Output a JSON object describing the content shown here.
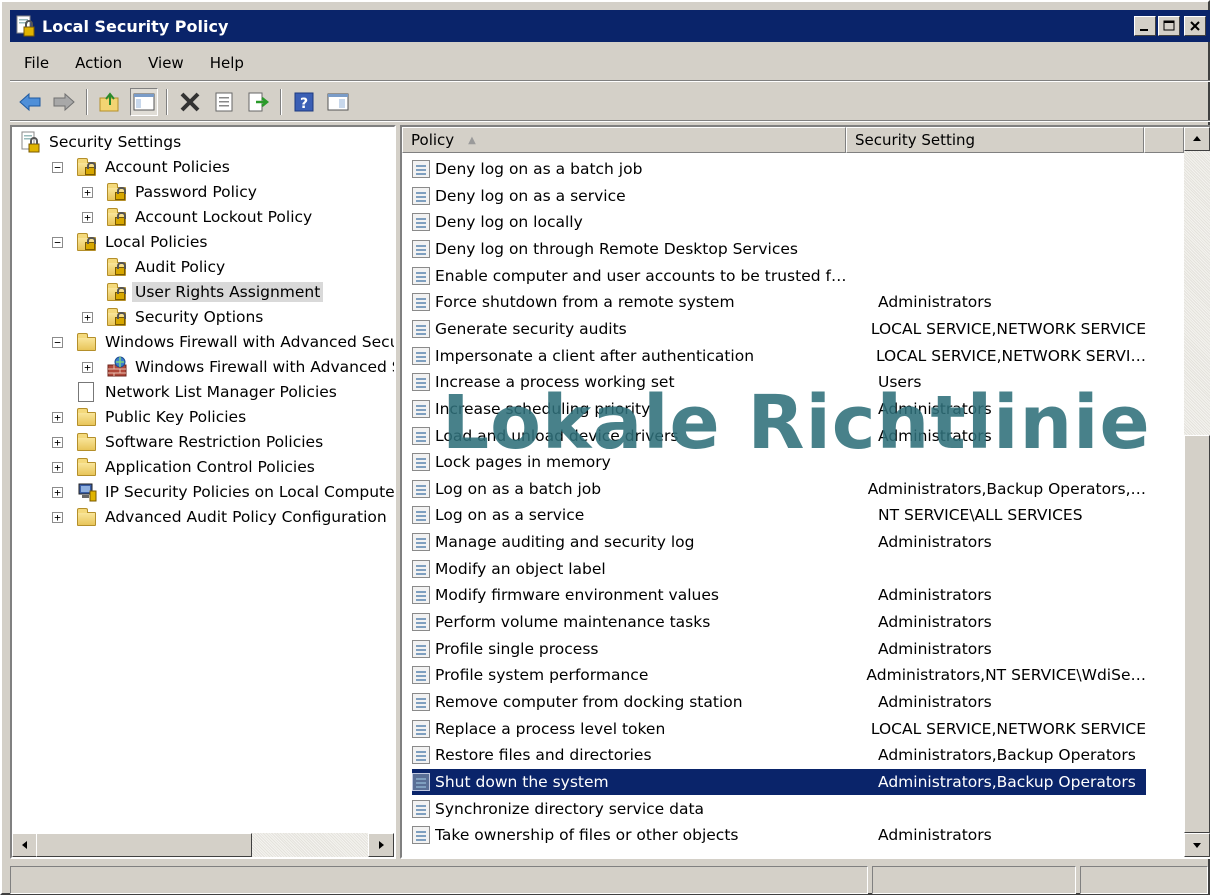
{
  "window": {
    "title": "Local Security Policy",
    "controls": {
      "minimize": "_",
      "maximize": "□",
      "close": "✕"
    }
  },
  "menu": [
    "File",
    "Action",
    "View",
    "Help"
  ],
  "toolbar": {
    "icons": [
      "back-arrow-icon",
      "forward-arrow-icon",
      "up-folder-icon",
      "show-hide-tree-icon",
      "delete-icon",
      "properties-icon",
      "export-list-icon",
      "help-icon",
      "console-tree-icon"
    ]
  },
  "tree": {
    "items": [
      {
        "label": "Security Settings",
        "indent": 0,
        "icon": "security-settings-icon",
        "expander": ""
      },
      {
        "label": "Account Policies",
        "indent": 1,
        "icon": "locked-folder-icon",
        "expander": "−"
      },
      {
        "label": "Password Policy",
        "indent": 2,
        "icon": "locked-folder-icon",
        "expander": "+"
      },
      {
        "label": "Account Lockout Policy",
        "indent": 2,
        "icon": "locked-folder-icon",
        "expander": "+"
      },
      {
        "label": "Local Policies",
        "indent": 1,
        "icon": "locked-folder-icon",
        "expander": "−"
      },
      {
        "label": "Audit Policy",
        "indent": 2,
        "icon": "locked-folder-icon",
        "expander": ""
      },
      {
        "label": "User Rights Assignment",
        "indent": 2,
        "icon": "locked-folder-icon",
        "expander": "",
        "selected": true
      },
      {
        "label": "Security Options",
        "indent": 2,
        "icon": "locked-folder-icon",
        "expander": "+"
      },
      {
        "label": "Windows Firewall with Advanced Security",
        "indent": 1,
        "icon": "folder-icon",
        "expander": "−"
      },
      {
        "label": "Windows Firewall with Advanced Secu",
        "indent": 2,
        "icon": "firewall-icon",
        "expander": "+"
      },
      {
        "label": "Network List Manager Policies",
        "indent": 1,
        "icon": "document-icon",
        "expander": ""
      },
      {
        "label": "Public Key Policies",
        "indent": 1,
        "icon": "folder-icon",
        "expander": "+"
      },
      {
        "label": "Software Restriction Policies",
        "indent": 1,
        "icon": "folder-icon",
        "expander": "+"
      },
      {
        "label": "Application Control Policies",
        "indent": 1,
        "icon": "folder-icon",
        "expander": "+"
      },
      {
        "label": "IP Security Policies on Local Computer",
        "indent": 1,
        "icon": "ip-security-icon",
        "expander": "+"
      },
      {
        "label": "Advanced Audit Policy Configuration",
        "indent": 1,
        "icon": "folder-icon",
        "expander": "+"
      }
    ]
  },
  "list": {
    "columns": {
      "policy": "Policy",
      "setting": "Security Setting"
    },
    "rows": [
      {
        "policy": "Deny log on as a batch job",
        "setting": ""
      },
      {
        "policy": "Deny log on as a service",
        "setting": ""
      },
      {
        "policy": "Deny log on locally",
        "setting": ""
      },
      {
        "policy": "Deny log on through Remote Desktop Services",
        "setting": ""
      },
      {
        "policy": "Enable computer and user accounts to be trusted f…",
        "setting": ""
      },
      {
        "policy": "Force shutdown from a remote system",
        "setting": "Administrators"
      },
      {
        "policy": "Generate security audits",
        "setting": "LOCAL SERVICE,NETWORK SERVICE"
      },
      {
        "policy": "Impersonate a client after authentication",
        "setting": "LOCAL SERVICE,NETWORK SERVI…"
      },
      {
        "policy": "Increase a process working set",
        "setting": "Users"
      },
      {
        "policy": "Increase scheduling priority",
        "setting": "Administrators"
      },
      {
        "policy": "Load and unload device drivers",
        "setting": "Administrators"
      },
      {
        "policy": "Lock pages in memory",
        "setting": ""
      },
      {
        "policy": "Log on as a batch job",
        "setting": "Administrators,Backup Operators,…"
      },
      {
        "policy": "Log on as a service",
        "setting": "NT SERVICE\\ALL SERVICES"
      },
      {
        "policy": "Manage auditing and security log",
        "setting": "Administrators"
      },
      {
        "policy": "Modify an object label",
        "setting": ""
      },
      {
        "policy": "Modify firmware environment values",
        "setting": "Administrators"
      },
      {
        "policy": "Perform volume maintenance tasks",
        "setting": "Administrators"
      },
      {
        "policy": "Profile single process",
        "setting": "Administrators"
      },
      {
        "policy": "Profile system performance",
        "setting": "Administrators,NT SERVICE\\WdiSe…"
      },
      {
        "policy": "Remove computer from docking station",
        "setting": "Administrators"
      },
      {
        "policy": "Replace a process level token",
        "setting": "LOCAL SERVICE,NETWORK SERVICE"
      },
      {
        "policy": "Restore files and directories",
        "setting": "Administrators,Backup Operators"
      },
      {
        "policy": "Shut down the system",
        "setting": "Administrators,Backup Operators",
        "selected": true
      },
      {
        "policy": "Synchronize directory service data",
        "setting": ""
      },
      {
        "policy": "Take ownership of files or other objects",
        "setting": "Administrators"
      }
    ]
  },
  "watermark": "Lokale Richtlinie",
  "colors": {
    "selection": "#0a246a",
    "watermark": "#2f6f7a"
  }
}
